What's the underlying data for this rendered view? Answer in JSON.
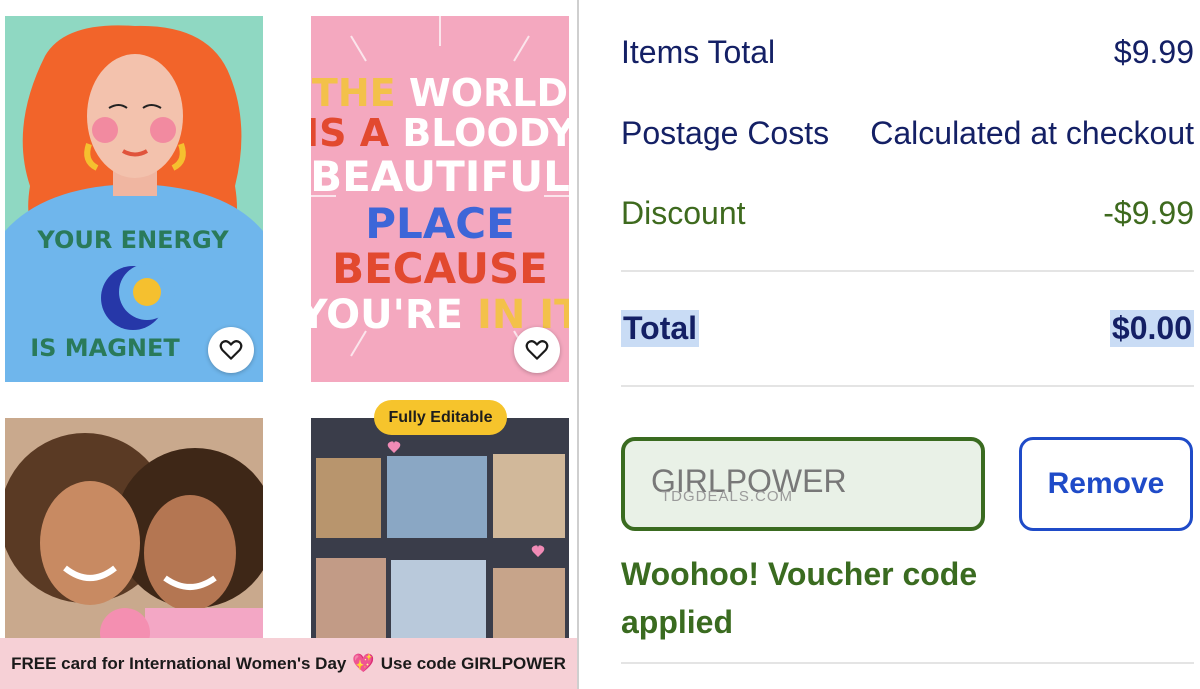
{
  "cards": [
    {
      "lettering": "YOUR ENERGY IS MAGNETIC"
    },
    {
      "lettering": "THE WORLD IS A BLOODY BEAUTIFUL PLACE BECAUSE YOU'RE IN IT"
    }
  ],
  "badge": "Fully Editable",
  "promo": {
    "text": "FREE card for International Women's Day",
    "heart": "💖",
    "code_text": "Use code GIRLPOWER"
  },
  "summary": {
    "items_label": "Items Total",
    "items_value": "$9.99",
    "postage_label": "Postage Costs",
    "postage_value": "Calculated at checkout",
    "discount_label": "Discount",
    "discount_value": "-$9.99",
    "total_label": "Total",
    "total_value": "$0.00"
  },
  "voucher": {
    "code": "GIRLPOWER",
    "watermark": "TDGDEALS.COM",
    "remove_label": "Remove",
    "applied_message": "Woohoo! Voucher code applied"
  },
  "colors": {
    "navy": "#142065",
    "green": "#3a6b20",
    "blue": "#1f4bc8",
    "promo_bg": "#f6d0d6",
    "badge": "#f6c42c"
  },
  "icons": [
    "heart-outline-icon"
  ]
}
